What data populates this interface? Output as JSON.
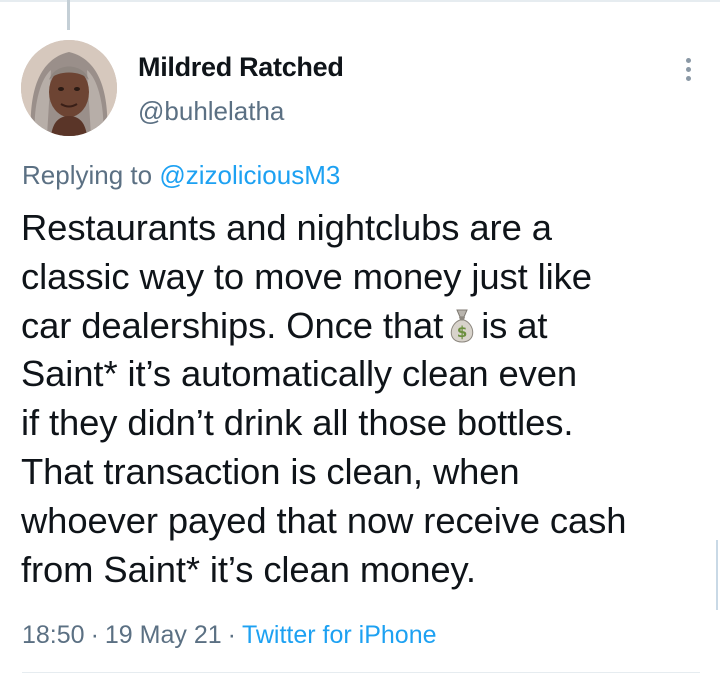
{
  "tweet": {
    "display_name": "Mildred Ratched",
    "handle": "@buhlelatha",
    "replying_to_prefix": "Replying to",
    "replying_to_handle": "@zizoliciousM3",
    "text_lines": [
      "Restaurants and nightclubs are a",
      "classic way to move money just like",
      "car dealerships. Once that",
      "is at",
      "Saint* it’s automatically clean even",
      "if they didn’t drink all those bottles.",
      "That transaction is clean, when",
      "whoever payed that now receive cash",
      "from Saint* it’s clean money."
    ],
    "emoji": "money-bag-icon",
    "time": "18:50",
    "date": "19 May 21",
    "source": "Twitter for iPhone",
    "separator": "·"
  },
  "colors": {
    "text": "#0f1419",
    "secondary": "#5b7083",
    "link": "#1da1f2",
    "border": "#e6ecf0"
  }
}
